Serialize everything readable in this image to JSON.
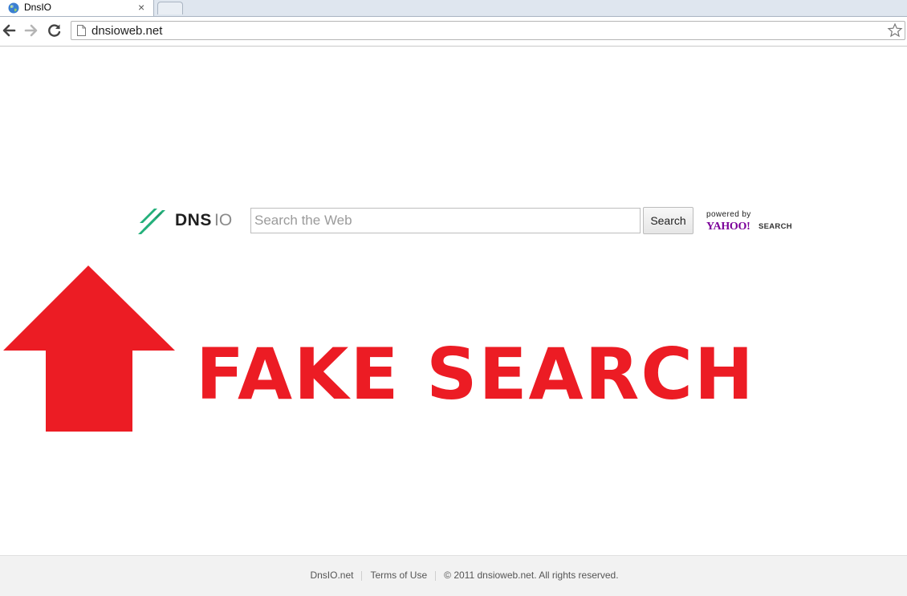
{
  "browser": {
    "tab_title": "DnsIO",
    "tab_close": "×",
    "url": "dnsioweb.net"
  },
  "page": {
    "logo": {
      "dns": "DNS",
      "io": "IO"
    },
    "search": {
      "placeholder": "Search the Web",
      "button_label": "Search"
    },
    "powered_by": {
      "text": "powered by",
      "brand": "YAHOO!",
      "brand_suffix": "SEARCH"
    },
    "annotation": {
      "text": "FAKE SEARCH",
      "color": "#ec1c24"
    }
  },
  "footer": {
    "links": [
      "DnsIO.net",
      "Terms of Use"
    ],
    "copyright": "© 2011 dnsioweb.net. All rights reserved."
  },
  "colors": {
    "accent_logo": "#23b07a",
    "yahoo": "#7b0099"
  }
}
